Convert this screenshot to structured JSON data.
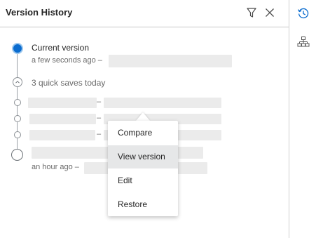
{
  "panel": {
    "title": "Version History"
  },
  "header_icons": [
    "filter-icon",
    "close-icon"
  ],
  "rail_icons": [
    "history-icon",
    "hierarchy-icon"
  ],
  "accent_color": "#0b6ccf",
  "timeline": {
    "current": {
      "label": "Current version",
      "time": "a few seconds ago –"
    },
    "group": {
      "label": "3 quick saves today",
      "icon": "chevron-up-icon"
    },
    "quick_saves": [
      {
        "separator": "–"
      },
      {
        "separator": "–"
      },
      {
        "separator": "–"
      }
    ],
    "older": {
      "time": "an hour ago –"
    }
  },
  "context_menu": {
    "items": [
      "Compare",
      "View version",
      "Edit",
      "Restore"
    ],
    "active_item": "View version"
  }
}
